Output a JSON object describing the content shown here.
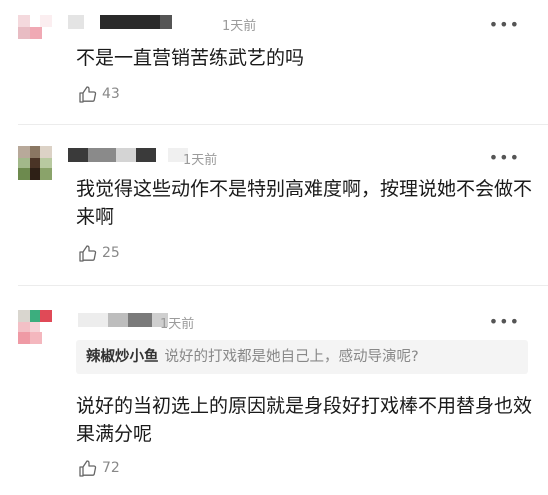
{
  "comments": [
    {
      "time": "1天前",
      "text": "不是一直营销苦练武艺的吗",
      "likes": "43"
    },
    {
      "time": "1天前",
      "text": "我觉得这些动作不是特别高难度啊，按理说她不会做不来啊",
      "likes": "25"
    },
    {
      "time": "1天前",
      "reply_to": {
        "name": "辣椒炒小鱼",
        "text": "说好的打戏都是她自己上，感动导演呢?"
      },
      "text": "说好的当初选上的原因就是身段好打戏棒不用替身也效果满分呢",
      "likes": "72"
    }
  ],
  "icons": {
    "more": "more-dots-icon",
    "like": "thumbs-up-icon"
  }
}
